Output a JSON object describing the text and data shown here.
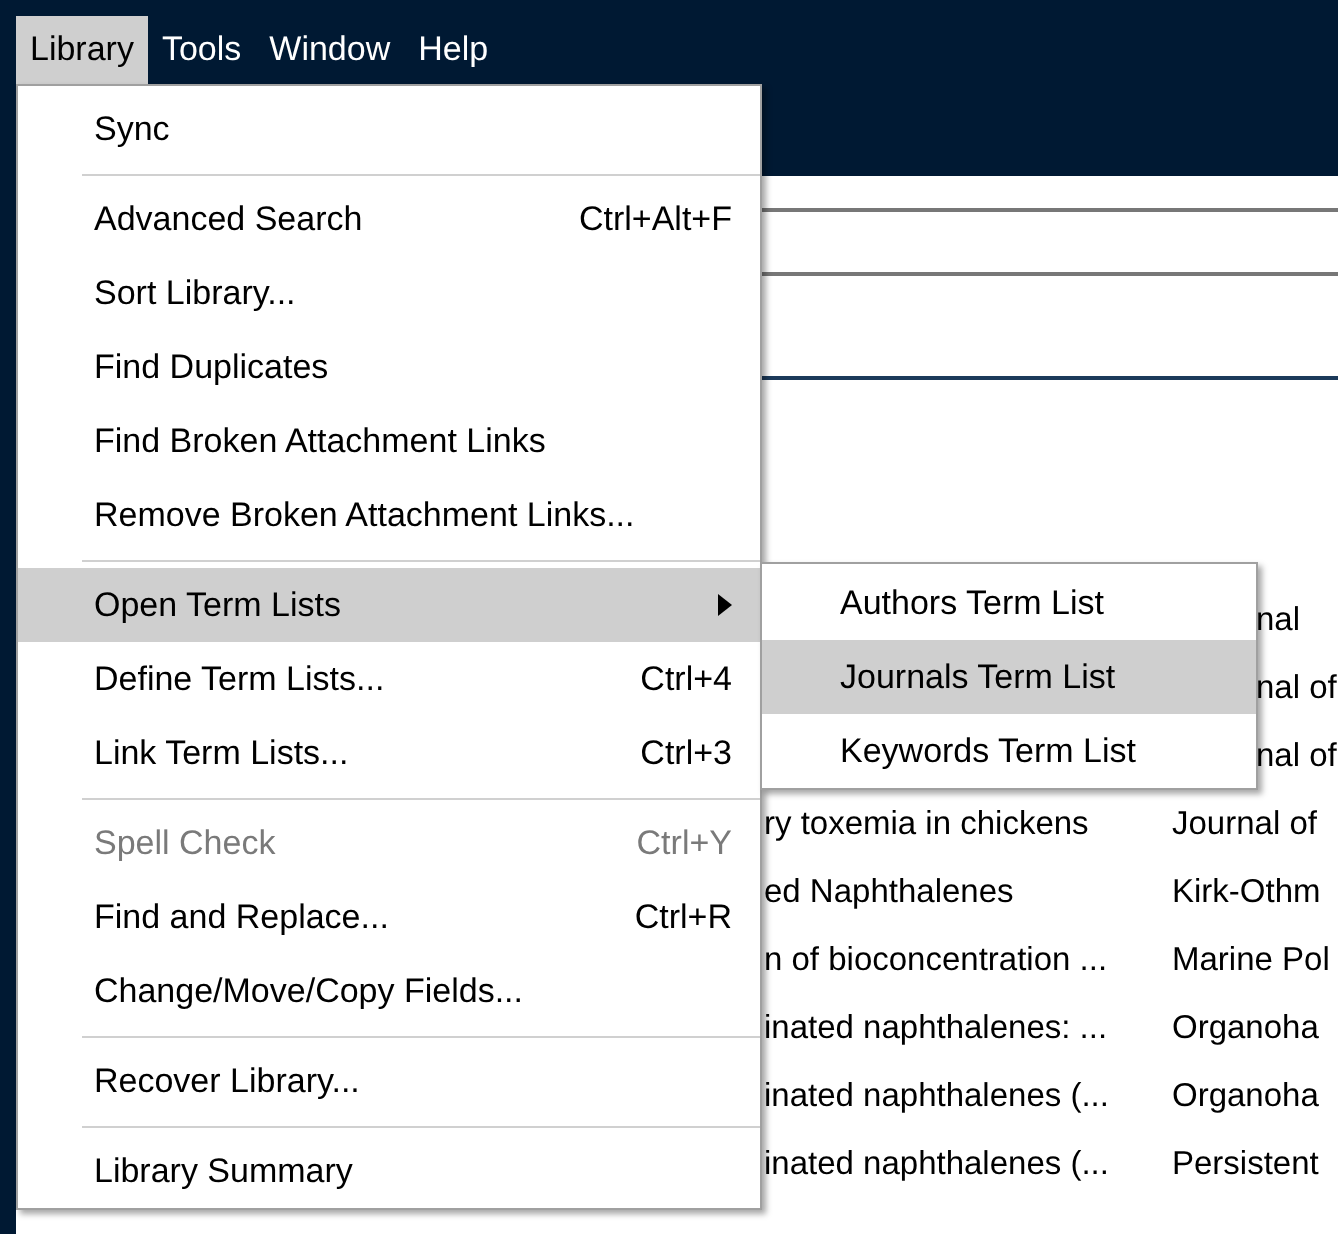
{
  "menubar": [
    {
      "label": "Library",
      "selected": true
    },
    {
      "label": "Tools",
      "selected": false
    },
    {
      "label": "Window",
      "selected": false
    },
    {
      "label": "Help",
      "selected": false
    }
  ],
  "menu": [
    {
      "kind": "item",
      "label": "Sync",
      "disabled": false,
      "selected": false
    },
    {
      "kind": "separator"
    },
    {
      "kind": "item",
      "label": "Advanced Search",
      "shortcut": "Ctrl+Alt+F",
      "disabled": false,
      "selected": false
    },
    {
      "kind": "item",
      "label": "Sort Library...",
      "disabled": false,
      "selected": false
    },
    {
      "kind": "item",
      "label": "Find Duplicates",
      "disabled": false,
      "selected": false
    },
    {
      "kind": "item",
      "label": "Find Broken Attachment Links",
      "disabled": false,
      "selected": false
    },
    {
      "kind": "item",
      "label": "Remove Broken Attachment Links...",
      "disabled": false,
      "selected": false
    },
    {
      "kind": "separator"
    },
    {
      "kind": "submenu",
      "label": "Open Term Lists",
      "disabled": false,
      "selected": true
    },
    {
      "kind": "item",
      "label": "Define Term Lists...",
      "shortcut": "Ctrl+4",
      "disabled": false,
      "selected": false
    },
    {
      "kind": "item",
      "label": "Link Term Lists...",
      "shortcut": "Ctrl+3",
      "disabled": false,
      "selected": false
    },
    {
      "kind": "separator"
    },
    {
      "kind": "item",
      "label": "Spell Check",
      "shortcut": "Ctrl+Y",
      "disabled": true,
      "selected": false
    },
    {
      "kind": "item",
      "label": "Find and Replace...",
      "shortcut": "Ctrl+R",
      "disabled": false,
      "selected": false
    },
    {
      "kind": "item",
      "label": "Change/Move/Copy Fields...",
      "disabled": false,
      "selected": false
    },
    {
      "kind": "separator"
    },
    {
      "kind": "item",
      "label": "Recover Library...",
      "disabled": false,
      "selected": false
    },
    {
      "kind": "separator"
    },
    {
      "kind": "item",
      "label": "Library Summary",
      "disabled": false,
      "selected": false
    }
  ],
  "submenu": [
    {
      "label": "Authors Term List",
      "selected": false
    },
    {
      "label": "Journals Term List",
      "selected": true
    },
    {
      "label": "Keywords Term List",
      "selected": false
    }
  ],
  "table": {
    "rows": [
      {
        "kind": "partial",
        "journal": "nal"
      },
      {
        "kind": "partial",
        "journal": "nal of"
      },
      {
        "kind": "partial",
        "journal": "nal of"
      },
      {
        "kind": "full",
        "title": "ry toxemia in chickens",
        "journal": "Journal of"
      },
      {
        "kind": "full",
        "title": "ed Naphthalenes",
        "journal": "Kirk-Othm"
      },
      {
        "kind": "full",
        "title": "n of bioconcentration ...",
        "journal": "Marine Pol"
      },
      {
        "kind": "full",
        "title": "inated naphthalenes: ...",
        "journal": "Organoha"
      },
      {
        "kind": "full",
        "title": "inated naphthalenes (...",
        "journal": "Organoha"
      },
      {
        "kind": "full",
        "title": "inated naphthalenes (...",
        "journal": "Persistent"
      }
    ]
  }
}
